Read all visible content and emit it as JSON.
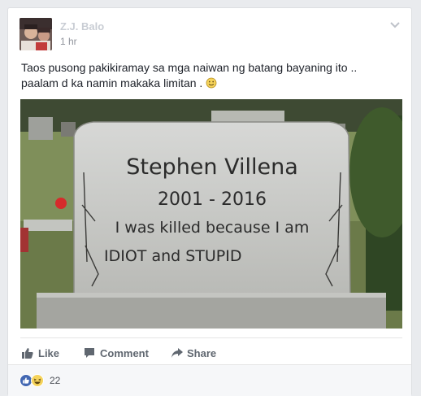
{
  "post": {
    "author": "Z.J. Balo",
    "time": "1 hr",
    "text": "Taos pusong pakikiramay sa mga naiwan ng batang bayaning ito .. paalam d ka namin makaka limitan .",
    "emoji_icon": "smile-emoji-icon"
  },
  "image": {
    "name": "Stephen Villena",
    "years": "2001  -  2016",
    "line1": "I was killed because I am",
    "line2": "IDIOT and STUPID"
  },
  "actions": {
    "like": "Like",
    "comment": "Comment",
    "share": "Share"
  },
  "reactions": {
    "count": "22",
    "icons": [
      "like-reaction-icon",
      "haha-reaction-icon"
    ]
  },
  "colors": {
    "link_blue": "#4267b2",
    "text": "#1d2129",
    "meta": "#90949c"
  }
}
